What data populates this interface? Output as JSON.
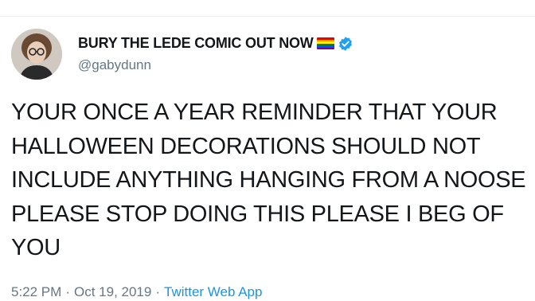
{
  "tweet": {
    "display_name": "BURY THE LEDE COMIC OUT NOW",
    "handle": "@gabydunn",
    "text": "YOUR ONCE A YEAR REMINDER THAT YOUR HALLOWEEN DECORATIONS SHOULD NOT INCLUDE ANYTHING HANGING FROM A NOOSE PLEASE STOP DOING THIS PLEASE I BEG OF YOU",
    "time": "5:22 PM",
    "date": "Oct 19, 2019",
    "separator": "·",
    "source": "Twitter Web App"
  },
  "icons": {
    "flag": "rainbow-flag-icon",
    "verified": "verified-badge-icon",
    "avatar": "profile-photo"
  },
  "colors": {
    "text": "#14171a",
    "secondary": "#657786",
    "link": "#1b95e0",
    "verified": "#1da1f2",
    "flag_stripes": [
      "#e40303",
      "#ff8c00",
      "#ffed00",
      "#008026",
      "#004dff",
      "#750787"
    ]
  }
}
